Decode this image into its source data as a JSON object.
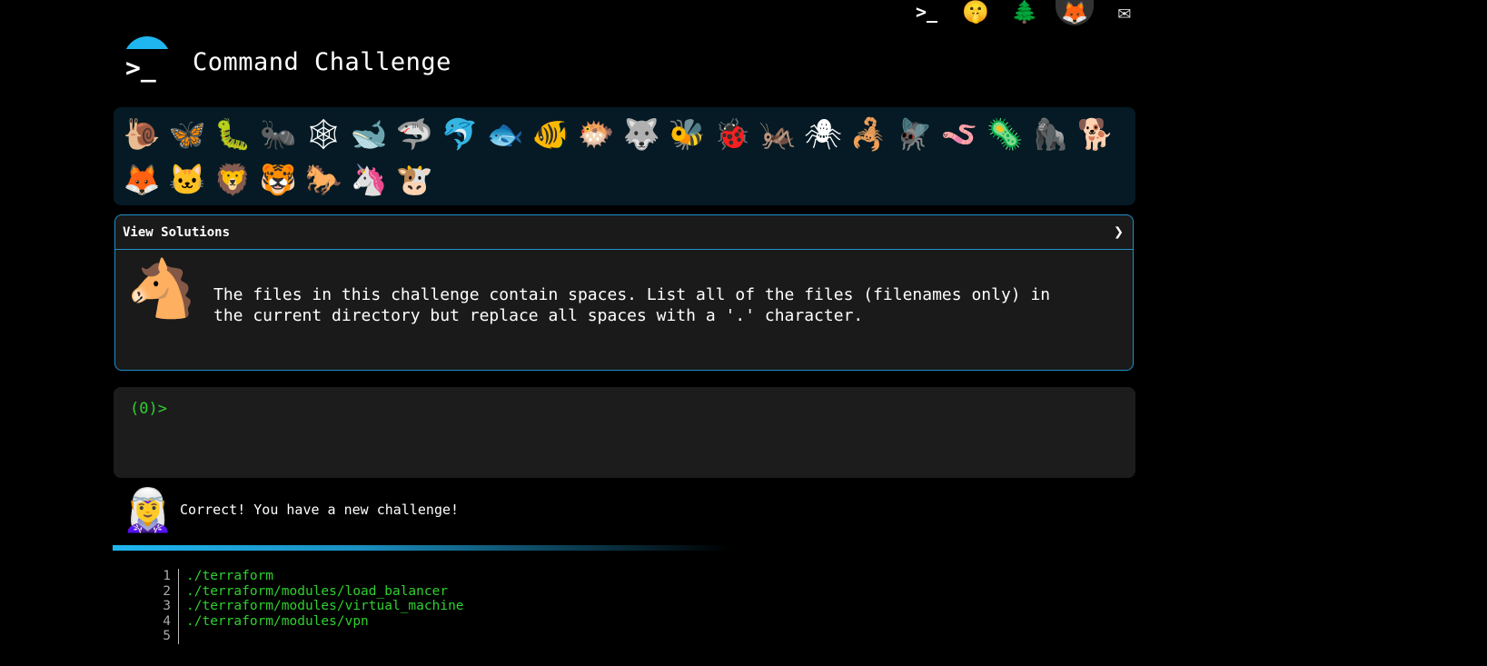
{
  "top_icons": [
    "terminal-icon",
    "shushing-face-icon",
    "tree-icon",
    "gitlab-icon",
    "mail-icon"
  ],
  "header": {
    "title": "Command Challenge"
  },
  "emoji_bar": [
    {
      "name": "snail-icon",
      "glyph": "🐌"
    },
    {
      "name": "butterfly-icon",
      "glyph": "🦋"
    },
    {
      "name": "caterpillar-icon",
      "glyph": "🐛"
    },
    {
      "name": "ant-icon",
      "glyph": "🐜"
    },
    {
      "name": "spider-web-icon",
      "glyph": "🕸"
    },
    {
      "name": "whale-icon",
      "glyph": "🐋"
    },
    {
      "name": "shark-icon",
      "glyph": "🦈"
    },
    {
      "name": "dolphin-icon",
      "glyph": "🐬"
    },
    {
      "name": "fish-icon",
      "glyph": "🐟"
    },
    {
      "name": "tropical-fish-icon",
      "glyph": "🐠"
    },
    {
      "name": "blowfish-icon",
      "glyph": "🐡"
    },
    {
      "name": "wolf-icon",
      "glyph": "🐺"
    },
    {
      "name": "bee-icon",
      "glyph": "🐝"
    },
    {
      "name": "ladybug-icon",
      "glyph": "🐞"
    },
    {
      "name": "cricket-icon",
      "glyph": "🦗"
    },
    {
      "name": "spider-icon",
      "glyph": "🕷"
    },
    {
      "name": "scorpion-icon",
      "glyph": "🦂"
    },
    {
      "name": "fly-icon",
      "glyph": "🪰"
    },
    {
      "name": "worm-icon",
      "glyph": "🪱"
    },
    {
      "name": "microbe-icon",
      "glyph": "🦠"
    },
    {
      "name": "gorilla-icon",
      "glyph": "🦍"
    },
    {
      "name": "dog-icon",
      "glyph": "🐕"
    },
    {
      "name": "fox-icon",
      "glyph": "🦊"
    },
    {
      "name": "cat-icon",
      "glyph": "🐱"
    },
    {
      "name": "lion-icon",
      "glyph": "🦁"
    },
    {
      "name": "tiger-icon",
      "glyph": "🐯"
    },
    {
      "name": "horse-icon",
      "glyph": "🐎"
    },
    {
      "name": "unicorn-icon",
      "glyph": "🦄"
    },
    {
      "name": "cow-icon",
      "glyph": "🐮"
    }
  ],
  "solutions": {
    "label": "View Solutions",
    "chevron": "❯",
    "avatar_icon": "horse-face-icon",
    "challenge_text": "The files in this challenge contain spaces. List all of the files (filenames only) in the current directory but replace all spaces with a '.' character."
  },
  "terminal": {
    "prompt": "(0)>"
  },
  "message": {
    "avatar_icon": "elf-icon",
    "text": "Correct! You have a new challenge!"
  },
  "output": {
    "line_numbers": [
      "1",
      "2",
      "3",
      "4",
      "5"
    ],
    "lines": [
      "./terraform",
      "./terraform/modules/load_balancer",
      "./terraform/modules/virtual_machine",
      "./terraform/modules/vpn",
      ""
    ]
  },
  "colors": {
    "accent": "#1fb6f0",
    "border": "#1d8fc7",
    "prompt_green": "#2fd02f",
    "panel_bg": "#1a1a1a",
    "emoji_bg": "#051a24"
  }
}
